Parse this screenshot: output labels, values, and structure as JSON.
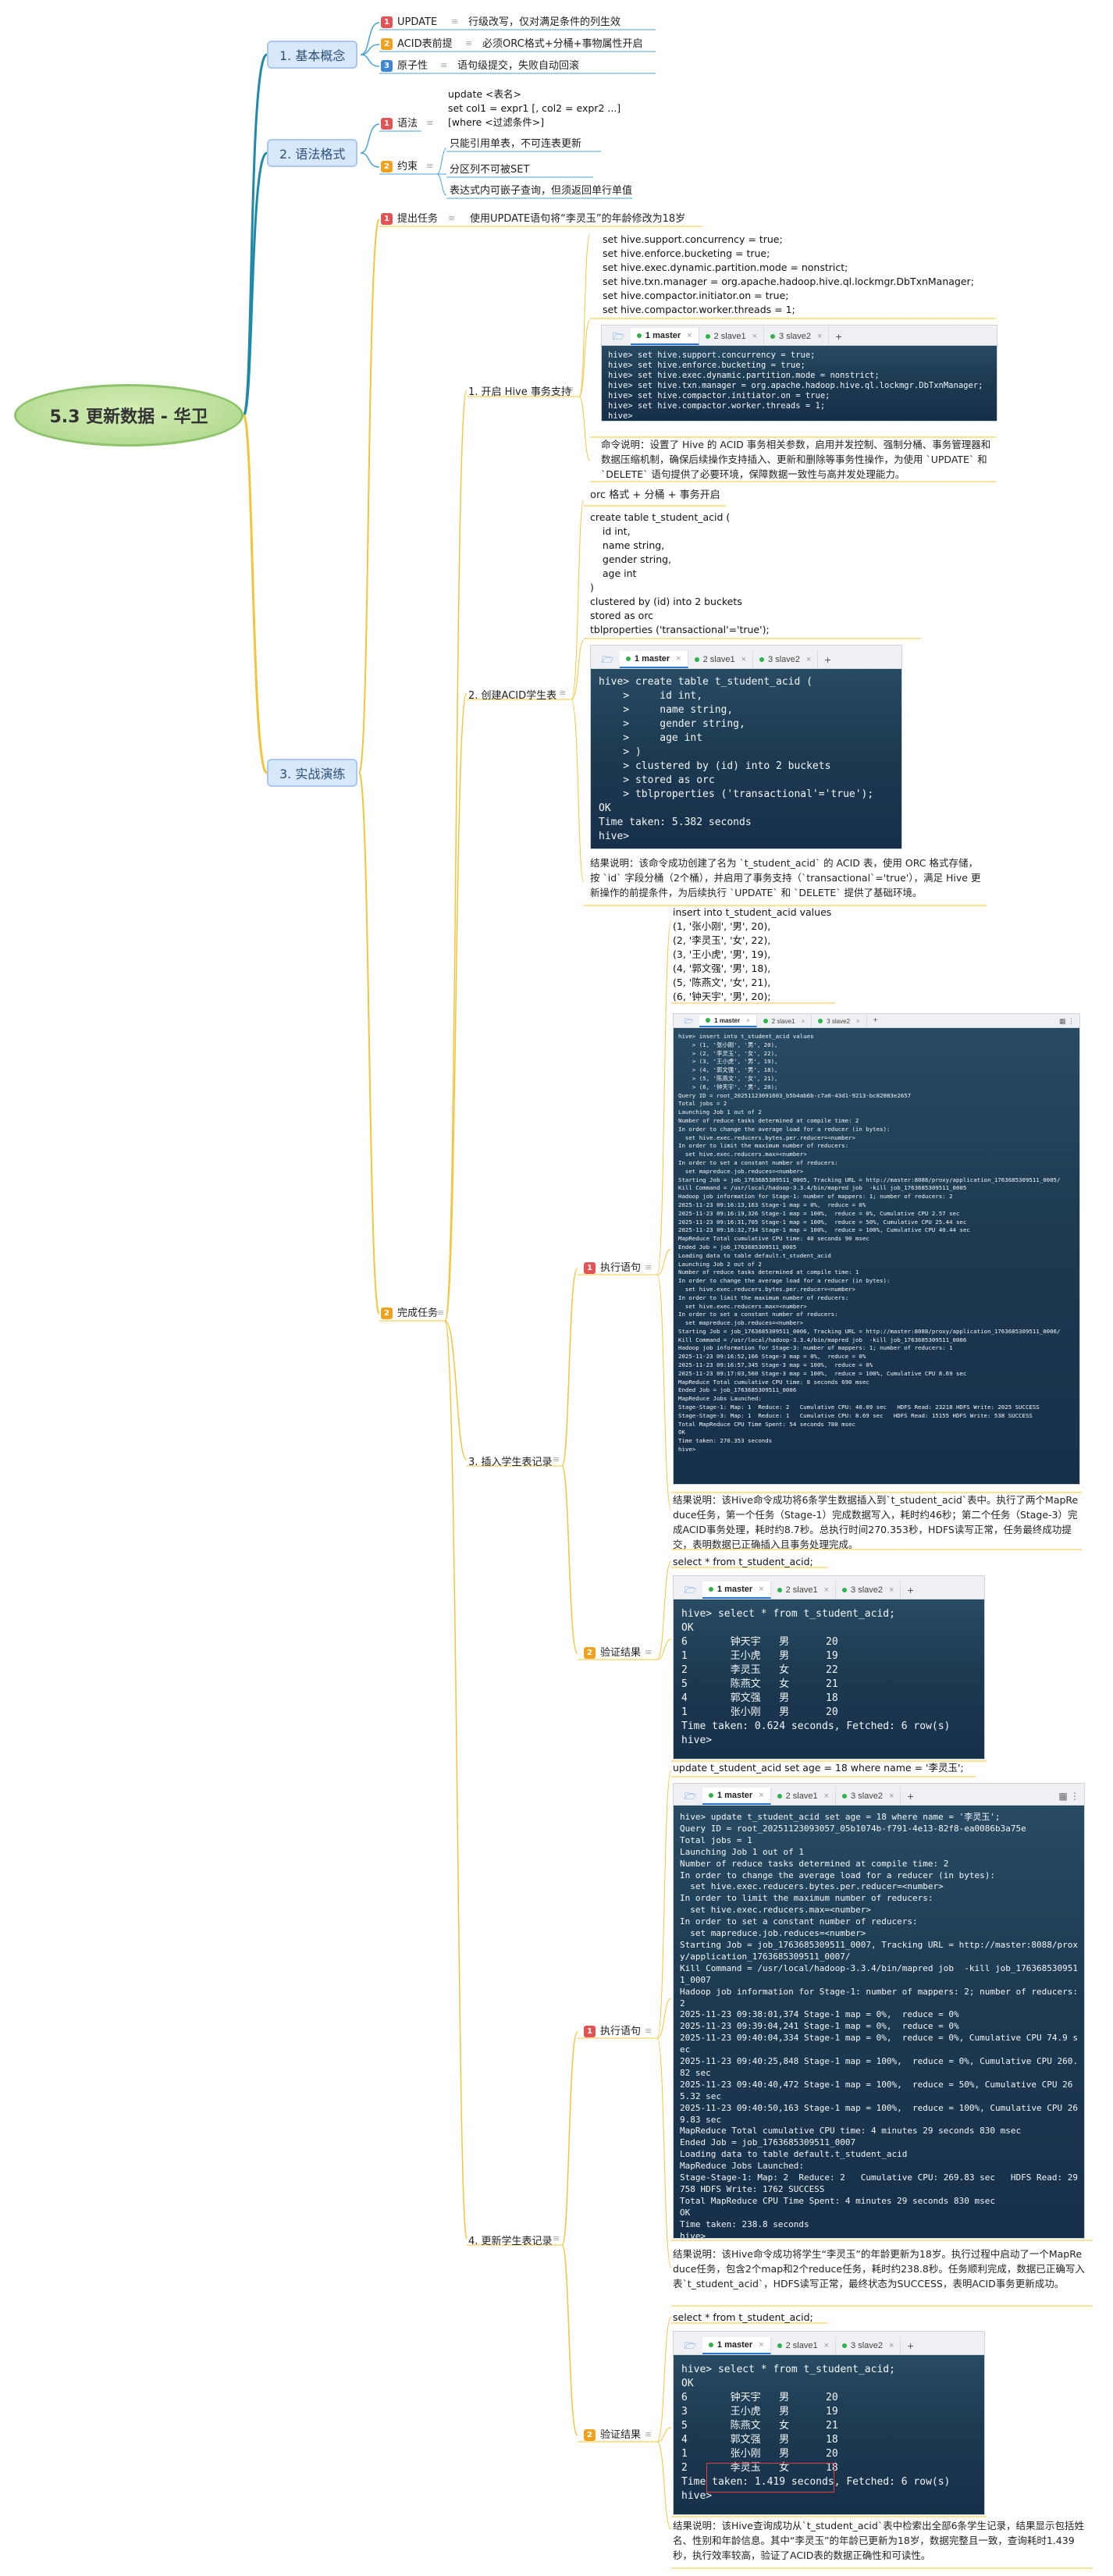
{
  "root": {
    "title": "5.3 更新数据 - 华卫"
  },
  "branches": {
    "concept": "1. 基本概念",
    "syntax": "2. 语法格式",
    "practice": "3. 实战演练"
  },
  "concept_items": [
    {
      "num": "1",
      "label": "UPDATE",
      "desc": "行级改写，仅对满足条件的列生效"
    },
    {
      "num": "2",
      "label": "ACID表前提",
      "desc": "必须ORC格式+分桶+事物属性开启"
    },
    {
      "num": "3",
      "label": "原子性",
      "desc": "语句级提交，失败自动回滚"
    }
  ],
  "syntax": {
    "grammar_label": "语法",
    "grammar_code": "update <表名>\nset col1 = expr1 [, col2 = expr2 ...]\n[where <过滤条件>]",
    "constraint_label": "约束",
    "constraints": [
      "只能引用单表，不可连表更新",
      "分区列不可被SET",
      "表达式内可嵌子查询，但须返回单行单值"
    ]
  },
  "practice": {
    "task_label": "提出任务",
    "task_desc": "使用UPDATE语句将“李灵玉”的年龄修改为18岁",
    "complete_label": "完成任务",
    "step1": {
      "label": "1. 开启 Hive 事务支持",
      "code": "set hive.support.concurrency = true;\nset hive.enforce.bucketing = true;\nset hive.exec.dynamic.partition.mode = nonstrict;\nset hive.txn.manager = org.apache.hadoop.hive.ql.lockmgr.DbTxnManager;\nset hive.compactor.initiator.on = true;\nset hive.compactor.worker.threads = 1;",
      "screen": "hive> set hive.support.concurrency = true;\nhive> set hive.enforce.bucketing = true;\nhive> set hive.exec.dynamic.partition.mode = nonstrict;\nhive> set hive.txn.manager = org.apache.hadoop.hive.ql.lockmgr.DbTxnManager;\nhive> set hive.compactor.initiator.on = true;\nhive> set hive.compactor.worker.threads = 1;\nhive>",
      "note": "命令说明：设置了 Hive 的 ACID 事务相关参数，启用并发控制、强制分桶、事务管理器和数据压缩机制，确保后续操作支持插入、更新和删除等事务性操作，为使用 `UPDATE` 和 `DELETE` 语句提供了必要环境，保障数据一致性与高并发处理能力。"
    },
    "step2": {
      "label": "2. 创建ACID学生表",
      "caption": "orc 格式 + 分桶 + 事务开启",
      "code": "create table t_student_acid (\n    id int,\n    name string,\n    gender string,\n    age int\n)\nclustered by (id) into 2 buckets\nstored as orc\ntblproperties ('transactional'='true');",
      "screen": "hive> create table t_student_acid (\n    >     id int,\n    >     name string,\n    >     gender string,\n    >     age int\n    > )\n    > clustered by (id) into 2 buckets\n    > stored as orc\n    > tblproperties ('transactional'='true');\nOK\nTime taken: 5.382 seconds\nhive>",
      "note": "结果说明：该命令成功创建了名为 `t_student_acid` 的 ACID 表，使用 ORC 格式存储，按 `id` 字段分桶（2个桶），并启用了事务支持（`transactional`='true'），满足 Hive 更新操作的前提条件，为后续执行 `UPDATE` 和 `DELETE` 提供了基础环境。"
    },
    "step3": {
      "label": "3. 插入学生表记录",
      "exec_label": "执行语句",
      "code": "insert into t_student_acid values\n(1, '张小刚', '男', 20),\n(2, '李灵玉', '女', 22),\n(3, '王小虎', '男', 19),\n(4, '郭文强', '男', 18),\n(5, '陈燕文', '女', 21),\n(6, '钟天宇', '男', 20);",
      "screen": "hive> insert into t_student_acid values\n    > (1, '张小刚', '男', 20),\n    > (2, '李灵玉', '女', 22),\n    > (3, '王小虎', '男', 19),\n    > (4, '郭文强', '男', 18),\n    > (5, '陈燕文', '女', 21),\n    > (6, '钟天宇', '男', 20);\nQuery ID = root_20251123091603_b5b4ab6b-c7a0-43d1-9213-bc82083e2657\nTotal jobs = 2\nLaunching Job 1 out of 2\nNumber of reduce tasks determined at compile time: 2\nIn order to change the average load for a reducer (in bytes):\n  set hive.exec.reducers.bytes.per.reducer=<number>\nIn order to limit the maximum number of reducers:\n  set hive.exec.reducers.max=<number>\nIn order to set a constant number of reducers:\n  set mapreduce.job.reduces=<number>\nStarting Job = job_1763685309511_0005, Tracking URL = http://master:8088/proxy/application_1763685309511_0005/\nKill Command = /usr/local/hadoop-3.3.4/bin/mapred job  -kill job_1763685309511_0005\nHadoop job information for Stage-1: number of mappers: 1; number of reducers: 2\n2025-11-23 09:16:13,163 Stage-1 map = 0%,  reduce = 0%\n2025-11-23 09:16:19,326 Stage-1 map = 100%,  reduce = 0%, Cumulative CPU 2.57 sec\n2025-11-23 09:16:31,705 Stage-1 map = 100%,  reduce = 50%, Cumulative CPU 25.44 sec\n2025-11-23 09:16:32,734 Stage-1 map = 100%,  reduce = 100%, Cumulative CPU 40.44 sec\nMapReduce Total cumulative CPU time: 40 seconds 90 msec\nEnded Job = job_1763685309511_0005\nLoading data to table default.t_student_acid\nLaunching Job 2 out of 2\nNumber of reduce tasks determined at compile time: 1\nIn order to change the average load for a reducer (in bytes):\n  set hive.exec.reducers.bytes.per.reducer=<number>\nIn order to limit the maximum number of reducers:\n  set hive.exec.reducers.max=<number>\nIn order to set a constant number of reducers:\n  set mapreduce.job.reduces=<number>\nStarting Job = job_1763685309511_0006, Tracking URL = http://master:8088/proxy/application_1763685309511_0006/\nKill Command = /usr/local/hadoop-3.3.4/bin/mapred job  -kill job_1763685309511_0006\nHadoop job information for Stage-3: number of mappers: 1; number of reducers: 1\n2025-11-23 09:16:52,166 Stage-3 map = 0%,  reduce = 0%\n2025-11-23 09:16:57,345 Stage-3 map = 100%,  reduce = 0%\n2025-11-23 09:17:03,560 Stage-3 map = 100%,  reduce = 100%, Cumulative CPU 8.69 sec\nMapReduce Total cumulative CPU time: 8 seconds 690 msec\nEnded Job = job_1763685309511_0006\nMapReduce Jobs Launched:\nStage-Stage-1: Map: 1  Reduce: 2   Cumulative CPU: 40.09 sec   HDFS Read: 23218 HDFS Write: 2025 SUCCESS\nStage-Stage-3: Map: 1  Reduce: 1   Cumulative CPU: 8.69 sec   HDFS Read: 15155 HDFS Write: 538 SUCCESS\nTotal MapReduce CPU Time Spent: 54 seconds 780 msec\nOK\nTime taken: 270.353 seconds\nhive>",
      "exec_note": "结果说明：该Hive命令成功将6条学生数据插入到`t_student_acid`表中。执行了两个MapReduce任务，第一个任务（Stage-1）完成数据写入，耗时约46秒；第二个任务（Stage-3）完成ACID事务处理，耗时约8.7秒。总执行时间270.353秒，HDFS读写正常，任务最终成功提交，表明数据已正确插入且事务处理完成。",
      "verify_label": "验证结果",
      "verify_code": "select * from t_student_acid;",
      "verify_screen": "hive> select * from t_student_acid;\nOK\n6       钟天宇   男      20\n1       王小虎   男      19\n2       李灵玉   女      22\n5       陈燕文   女      21\n4       郭文强   男      18\n1       张小刚   男      20\nTime taken: 0.624 seconds, Fetched: 6 row(s)\nhive>"
    },
    "step4": {
      "label": "4. 更新学生表记录",
      "exec_label": "执行语句",
      "code": "update t_student_acid set age = 18 where name = '李灵玉';",
      "screen": "hive> update t_student_acid set age = 18 where name = '李灵玉';\nQuery ID = root_20251123093057_05b1074b-f791-4e13-82f8-ea0086b3a75e\nTotal jobs = 1\nLaunching Job 1 out of 1\nNumber of reduce tasks determined at compile time: 2\nIn order to change the average load for a reducer (in bytes):\n  set hive.exec.reducers.bytes.per.reducer=<number>\nIn order to limit the maximum number of reducers:\n  set hive.exec.reducers.max=<number>\nIn order to set a constant number of reducers:\n  set mapreduce.job.reduces=<number>\nStarting Job = job_1763685309511_0007, Tracking URL = http://master:8088/proxy/application_1763685309511_0007/\nKill Command = /usr/local/hadoop-3.3.4/bin/mapred job  -kill job_1763685309511_0007\nHadoop job information for Stage-1: number of mappers: 2; number of reducers: 2\n2025-11-23 09:38:01,374 Stage-1 map = 0%,  reduce = 0%\n2025-11-23 09:39:04,241 Stage-1 map = 0%,  reduce = 0%\n2025-11-23 09:40:04,334 Stage-1 map = 0%,  reduce = 0%, Cumulative CPU 74.9 sec\n2025-11-23 09:40:25,848 Stage-1 map = 100%,  reduce = 0%, Cumulative CPU 260.82 sec\n2025-11-23 09:40:40,472 Stage-1 map = 100%,  reduce = 50%, Cumulative CPU 265.32 sec\n2025-11-23 09:40:50,163 Stage-1 map = 100%,  reduce = 100%, Cumulative CPU 269.83 sec\nMapReduce Total cumulative CPU time: 4 minutes 29 seconds 830 msec\nEnded Job = job_1763685309511_0007\nLoading data to table default.t_student_acid\nMapReduce Jobs Launched:\nStage-Stage-1: Map: 2  Reduce: 2   Cumulative CPU: 269.83 sec   HDFS Read: 29758 HDFS Write: 1762 SUCCESS\nTotal MapReduce CPU Time Spent: 4 minutes 29 seconds 830 msec\nOK\nTime taken: 238.8 seconds\nhive>",
      "exec_note": "结果说明：该Hive命令成功将学生“李灵玉”的年龄更新为18岁。执行过程中启动了一个MapReduce任务，包含2个map和2个reduce任务，耗时约238.8秒。任务顺利完成，数据已正确写入表`t_student_acid`，HDFS读写正常，最终状态为SUCCESS，表明ACID事务更新成功。",
      "verify_label": "验证结果",
      "verify_code": "select * from t_student_acid;",
      "verify_screen": "hive> select * from t_student_acid;\nOK\n6       钟天宇   男      20\n3       王小虎   男      19\n5       陈燕文   女      21\n4       郭文强   男      18\n1       张小刚   男      20\n2       李灵玉   女      18\nTime taken: 1.419 seconds, Fetched: 6 row(s)\nhive>",
      "verify_note": "结果说明：该Hive查询成功从`t_student_acid`表中检索出全部6条学生记录，结果显示包括姓名、性别和年龄信息。其中“李灵玉”的年龄已更新为18岁，数据完整且一致，查询耗时1.439秒，执行效率较高，验证了ACID表的数据正确性和可读性。"
    }
  },
  "terminal_tabs": {
    "t1": "1 master",
    "t2": "2 slave1",
    "t3": "3 slave2",
    "plus": "+"
  },
  "colors": {
    "branch_fill": "#d7e8fb",
    "root_fill": "#c2e3a3",
    "line_concept": "#4ba3d8",
    "line_practice": "#f2c53d",
    "num_red": "#e35353",
    "num_orange": "#f0a21e",
    "num_blue": "#3f86d6"
  }
}
